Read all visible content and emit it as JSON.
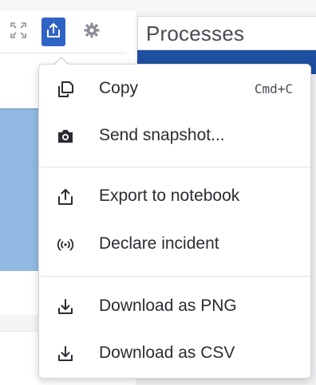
{
  "panel": {
    "title": "Processes"
  },
  "toolbar": {
    "buttons": [
      {
        "icon": "expand-icon"
      },
      {
        "icon": "share-icon"
      },
      {
        "icon": "gear-icon"
      }
    ]
  },
  "menu": {
    "items": [
      {
        "label": "Copy",
        "shortcut": "Cmd+C",
        "icon": "copy-icon"
      },
      {
        "label": "Send snapshot...",
        "icon": "camera-icon"
      },
      {
        "label": "Export to notebook",
        "icon": "export-icon"
      },
      {
        "label": "Declare incident",
        "icon": "incident-icon"
      },
      {
        "label": "Download as PNG",
        "icon": "download-icon"
      },
      {
        "label": "Download as CSV",
        "icon": "download-icon"
      }
    ]
  },
  "colors": {
    "accent": "#2f63c6",
    "panel_blue": "#1f4fa0",
    "graph_blue": "#90b8e2"
  }
}
